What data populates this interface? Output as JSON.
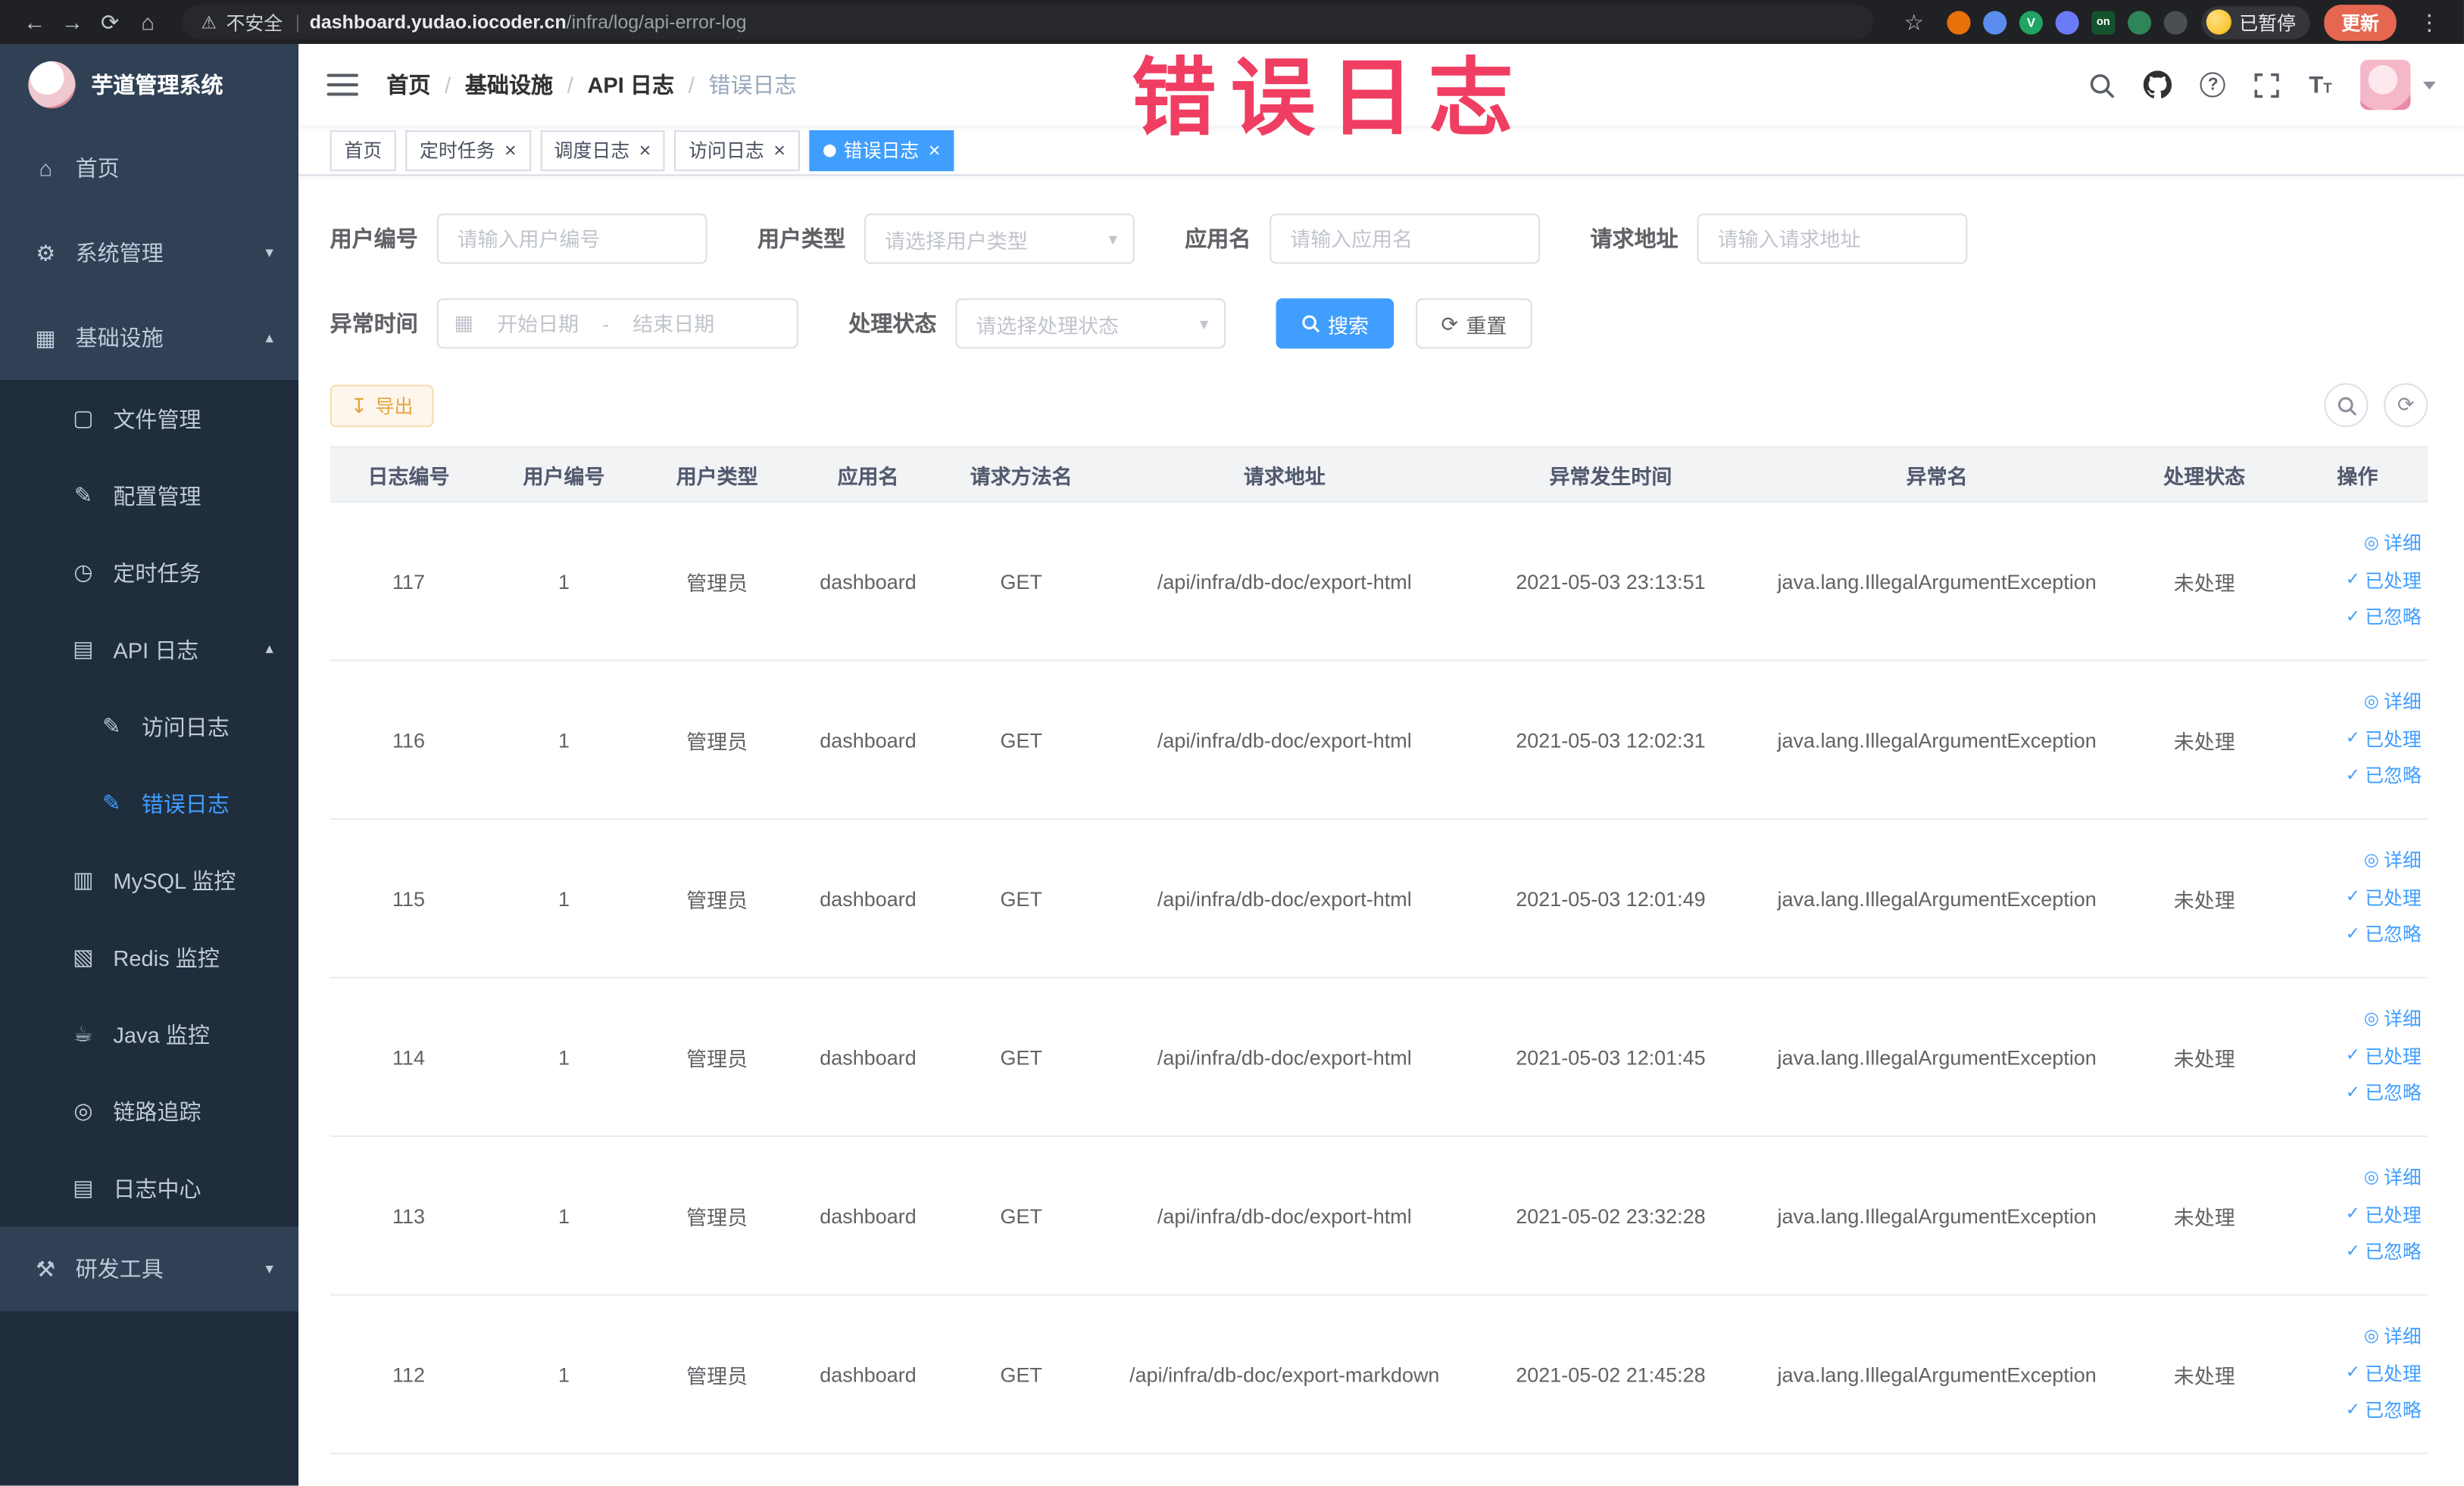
{
  "browser": {
    "security_label": "不安全",
    "url_domain": "dashboard.yudao.iocoder.cn",
    "url_path": "/infra/log/api-error-log",
    "paused_badge": "已暂停",
    "update_button": "更新",
    "extensions": [
      {
        "name": "extension-orange-icon",
        "color": "#e8710a",
        "glyph": ""
      },
      {
        "name": "extension-drop-icon",
        "color": "#5b8def",
        "glyph": ""
      },
      {
        "name": "extension-v-icon",
        "color": "#1fa463",
        "glyph": "V"
      },
      {
        "name": "extension-grid-icon",
        "color": "#6b7bf7",
        "glyph": ""
      },
      {
        "name": "extension-on-badge-icon",
        "color": "#14532d",
        "glyph": "on"
      },
      {
        "name": "extension-tree-icon",
        "color": "#2f855a",
        "glyph": ""
      },
      {
        "name": "extension-pin-icon",
        "color": "#4b4e52",
        "glyph": ""
      }
    ]
  },
  "overlay": {
    "title": "错误日志",
    "color": "#f03e62"
  },
  "icons": {
    "back": "←",
    "forward": "→",
    "reload": "⟳",
    "home": "⌂",
    "warning": "⚠",
    "star": "☆",
    "menu_dots": "⋮",
    "gear": "⚙",
    "infra": "▦",
    "file": "▢",
    "config": "✎",
    "job": "◷",
    "api_log": "▤",
    "doc_edit": "✎",
    "mysql": "▥",
    "redis": "▧",
    "java": "☕",
    "trace": "◎",
    "log_center": "▤",
    "devtools": "⚒",
    "chevron_down": "▾",
    "chevron_up": "▴",
    "calendar": "▦",
    "refresh": "⟳",
    "download": "↧",
    "eye": "◎",
    "check": "✓",
    "close": "×"
  },
  "sidebar": {
    "logo_title": "芋道管理系统",
    "menu": [
      {
        "name": "sidebar-item-home",
        "label": "首页",
        "icon": "home",
        "level": 0
      },
      {
        "name": "sidebar-item-system",
        "label": "系统管理",
        "icon": "gear",
        "level": 0,
        "arrow": "down"
      },
      {
        "name": "sidebar-item-infra",
        "label": "基础设施",
        "icon": "infra",
        "level": 0,
        "arrow": "up"
      },
      {
        "name": "sidebar-item-file-manage",
        "label": "文件管理",
        "icon": "file",
        "level": 1
      },
      {
        "name": "sidebar-item-config-manage",
        "label": "配置管理",
        "icon": "config",
        "level": 1
      },
      {
        "name": "sidebar-item-job",
        "label": "定时任务",
        "icon": "job",
        "level": 1
      },
      {
        "name": "sidebar-item-api-log",
        "label": "API 日志",
        "icon": "api_log",
        "level": 1,
        "arrow": "up"
      },
      {
        "name": "sidebar-item-access-log",
        "label": "访问日志",
        "icon": "doc_edit",
        "level": 2
      },
      {
        "name": "sidebar-item-error-log",
        "label": "错误日志",
        "icon": "doc_edit",
        "level": 2,
        "active": true
      },
      {
        "name": "sidebar-item-mysql-monitor",
        "label": "MySQL 监控",
        "icon": "mysql",
        "level": 1
      },
      {
        "name": "sidebar-item-redis-monitor",
        "label": "Redis 监控",
        "icon": "redis",
        "level": 1
      },
      {
        "name": "sidebar-item-java-monitor",
        "label": "Java 监控",
        "icon": "java",
        "level": 1
      },
      {
        "name": "sidebar-item-trace",
        "label": "链路追踪",
        "icon": "trace",
        "level": 1
      },
      {
        "name": "sidebar-item-log-center",
        "label": "日志中心",
        "icon": "log_center",
        "level": 1
      },
      {
        "name": "sidebar-item-devtools",
        "label": "研发工具",
        "icon": "devtools",
        "level": 0,
        "arrow": "down"
      }
    ]
  },
  "breadcrumb": [
    "首页",
    "基础设施",
    "API 日志",
    "错误日志"
  ],
  "tabs": [
    {
      "name": "tab-home",
      "label": "首页",
      "closable": false,
      "active": false
    },
    {
      "name": "tab-job",
      "label": "定时任务",
      "closable": true,
      "active": false
    },
    {
      "name": "tab-job-log",
      "label": "调度日志",
      "closable": true,
      "active": false
    },
    {
      "name": "tab-access-log",
      "label": "访问日志",
      "closable": true,
      "active": false
    },
    {
      "name": "tab-error-log",
      "label": "错误日志",
      "closable": true,
      "active": true
    }
  ],
  "filters": {
    "user_id": {
      "label": "用户编号",
      "placeholder": "请输入用户编号"
    },
    "user_type": {
      "label": "用户类型",
      "placeholder": "请选择用户类型"
    },
    "app_name": {
      "label": "应用名",
      "placeholder": "请输入应用名"
    },
    "request_url": {
      "label": "请求地址",
      "placeholder": "请输入请求地址"
    },
    "exception_time": {
      "label": "异常时间",
      "start_placeholder": "开始日期",
      "separator": "-",
      "end_placeholder": "结束日期"
    },
    "process_status": {
      "label": "处理状态",
      "placeholder": "请选择处理状态"
    },
    "search_button": "搜索",
    "reset_button": "重置"
  },
  "toolbar": {
    "export_button": "导出"
  },
  "table": {
    "columns": [
      "日志编号",
      "用户编号",
      "用户类型",
      "应用名",
      "请求方法名",
      "请求地址",
      "异常发生时间",
      "异常名",
      "处理状态",
      "操作"
    ],
    "actions": [
      "详细",
      "已处理",
      "已忽略"
    ],
    "rows": [
      {
        "id": "117",
        "user_id": "1",
        "user_type": "管理员",
        "app": "dashboard",
        "method": "GET",
        "url": "/api/infra/db-doc/export-html",
        "time": "2021-05-03 23:13:51",
        "exception": "java.lang.IllegalArgumentException",
        "status": "未处理"
      },
      {
        "id": "116",
        "user_id": "1",
        "user_type": "管理员",
        "app": "dashboard",
        "method": "GET",
        "url": "/api/infra/db-doc/export-html",
        "time": "2021-05-03 12:02:31",
        "exception": "java.lang.IllegalArgumentException",
        "status": "未处理"
      },
      {
        "id": "115",
        "user_id": "1",
        "user_type": "管理员",
        "app": "dashboard",
        "method": "GET",
        "url": "/api/infra/db-doc/export-html",
        "time": "2021-05-03 12:01:49",
        "exception": "java.lang.IllegalArgumentException",
        "status": "未处理"
      },
      {
        "id": "114",
        "user_id": "1",
        "user_type": "管理员",
        "app": "dashboard",
        "method": "GET",
        "url": "/api/infra/db-doc/export-html",
        "time": "2021-05-03 12:01:45",
        "exception": "java.lang.IllegalArgumentException",
        "status": "未处理"
      },
      {
        "id": "113",
        "user_id": "1",
        "user_type": "管理员",
        "app": "dashboard",
        "method": "GET",
        "url": "/api/infra/db-doc/export-html",
        "time": "2021-05-02 23:32:28",
        "exception": "java.lang.IllegalArgumentException",
        "status": "未处理"
      },
      {
        "id": "112",
        "user_id": "1",
        "user_type": "管理员",
        "app": "dashboard",
        "method": "GET",
        "url": "/api/infra/db-doc/export-markdown",
        "time": "2021-05-02 21:45:28",
        "exception": "java.lang.IllegalArgumentException",
        "status": "未处理"
      }
    ]
  }
}
